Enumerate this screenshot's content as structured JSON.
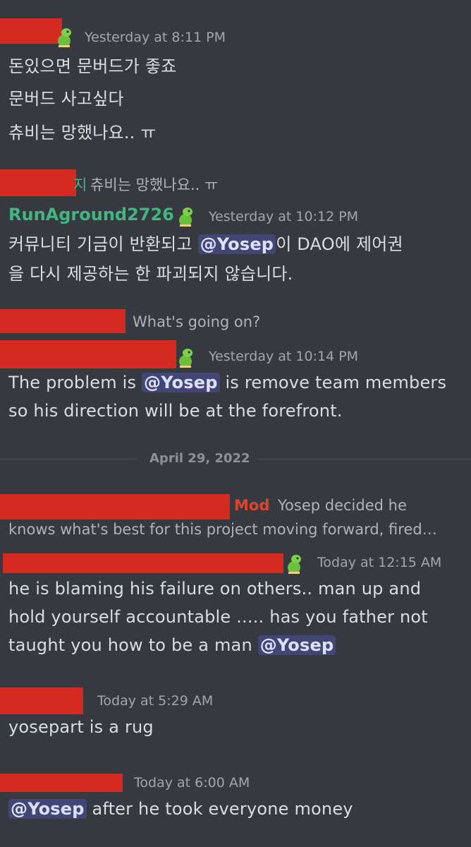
{
  "colors": {
    "background": "#36393f",
    "redaction": "#d42a20",
    "username": "#43b581",
    "mod_tag": "#e0452c",
    "mention_bg": "#414675",
    "mention_text": "#dee0fc"
  },
  "messages": {
    "m1": {
      "timestamp": "Yesterday at 8:11 PM",
      "lines": [
        "돈있으면 문버드가 좋죠",
        "문버드 사고싶다",
        "츄비는 망했나요.. ㅠ"
      ]
    },
    "m2": {
      "reply_prefix": "지",
      "reply_text": "츄비는 망했나요.. ㅠ",
      "username": "RunAground2726",
      "timestamp": "Yesterday at 10:12 PM",
      "line1_before": "커뮤니티 기금이 반환되고 ",
      "mention": "@Yosep",
      "line1_after": "이 DAO에 제어권",
      "line2": "을 다시 제공하는 한 파괴되지 않습니다."
    },
    "m3": {
      "reply_text": "What's going on?",
      "timestamp": "Yesterday at 10:14 PM",
      "line1_before": "The problem is ",
      "mention": "@Yosep",
      "line1_after": " is remove team members",
      "line2": "so his direction will be at the forefront."
    },
    "divider": {
      "date": "April 29, 2022"
    },
    "m4": {
      "reply_tag": "Mod",
      "reply_text_1": "Yosep decided he",
      "reply_text_2": "knows what's best for this project moving forward, fired…",
      "timestamp": "Today at 12:15 AM",
      "line1": "he is blaming his failure on others.. man up and",
      "line2": "hold yourself accountable ..... has you father not",
      "line3_before": "taught you how to be a man ",
      "mention": "@Yosep"
    },
    "m5": {
      "timestamp": "Today at 5:29 AM",
      "line1": "yosepart is a rug"
    },
    "m6": {
      "timestamp": "Today at 6:00 AM",
      "mention": "@Yosep",
      "line1_after": " after he took everyone money"
    }
  }
}
